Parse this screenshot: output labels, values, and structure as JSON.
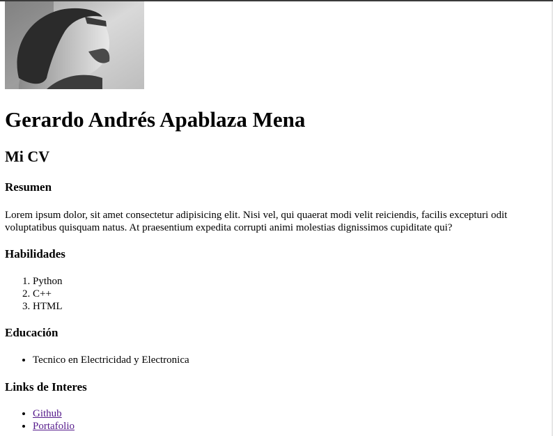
{
  "profile": {
    "name": "Gerardo Andrés Apablaza Mena",
    "cv_title": "Mi CV"
  },
  "summary": {
    "heading": "Resumen",
    "text": "Lorem ipsum dolor, sit amet consectetur adipisicing elit. Nisi vel, qui quaerat modi velit reiciendis, facilis excepturi odit voluptatibus quisquam natus. At praesentium expedita corrupti animi molestias dignissimos cupiditate qui?"
  },
  "skills": {
    "heading": "Habilidades",
    "items": [
      "Python",
      "C++",
      "HTML"
    ]
  },
  "education": {
    "heading": "Educación",
    "items": [
      "Tecnico en Electricidad y Electronica"
    ]
  },
  "links": {
    "heading": "Links de Interes",
    "items": [
      "Github",
      "Portafolio"
    ]
  },
  "colors": {
    "link_visited": "#551a8b",
    "text": "#000000",
    "background": "#ffffff"
  }
}
